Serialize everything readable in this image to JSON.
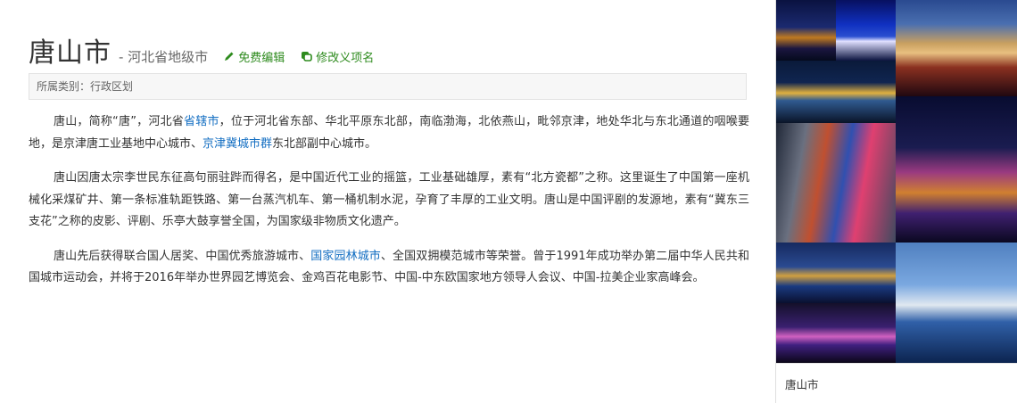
{
  "entry": {
    "title": "唐山市",
    "subtitle": "- 河北省地级市",
    "edit_label": "免费编辑",
    "modify_label": "修改义项名",
    "category": "所属类别：行政区划"
  },
  "paragraphs": [
    [
      {
        "text": "唐山，简称“唐”，河北省"
      },
      {
        "text": "省辖市",
        "link": true
      },
      {
        "text": "，位于河北省东部、华北平原东北部，南临渤海，北依燕山，毗邻京津，地处华北与东北通道的咽喉要地，是京津唐工业基地中心城市、"
      },
      {
        "text": "京津冀城市群",
        "link": true
      },
      {
        "text": "东北部副中心城市。"
      }
    ],
    [
      {
        "text": "唐山因唐太宗李世民东征高句丽驻跸而得名，是中国近代工业的摇篮，工业基础雄厚，素有“北方瓷都”之称。这里诞生了中国第一座机械化采煤矿井、第一条标准轨距铁路、第一台蒸汽机车、第一桶机制水泥，孕育了丰厚的工业文明。唐山是中国评剧的发源地，素有“冀东三支花”之称的皮影、评剧、乐亭大鼓享誉全国，为国家级非物质文化遗产。"
      }
    ],
    [
      {
        "text": "唐山先后获得联合国人居奖、中国优秀旅游城市、"
      },
      {
        "text": "国家园林城市",
        "link": true
      },
      {
        "text": "、全国双拥模范城市等荣誉。曾于1991年成功举办第二届中华人民共和国城市运动会，并将于2016年举办世界园艺博览会、金鸡百花电影节、中国-中东欧国家地方领导人会议、中国-拉美企业家高峰会。"
      }
    ]
  ],
  "album": {
    "caption": "唐山市",
    "photos": [
      {
        "name": "photo-night-bridge-skyline"
      },
      {
        "name": "photo-blue-night-towers"
      },
      {
        "name": "photo-railway-station"
      },
      {
        "name": "photo-arch-bridge-lights"
      },
      {
        "name": "photo-highrise-aerial"
      },
      {
        "name": "photo-river-panorama"
      },
      {
        "name": "photo-waterfront-city"
      },
      {
        "name": "photo-cable-bridge"
      },
      {
        "name": "photo-purple-night-building"
      }
    ]
  },
  "colors": {
    "link": "#136ec2",
    "action": "#2e8b1e"
  }
}
